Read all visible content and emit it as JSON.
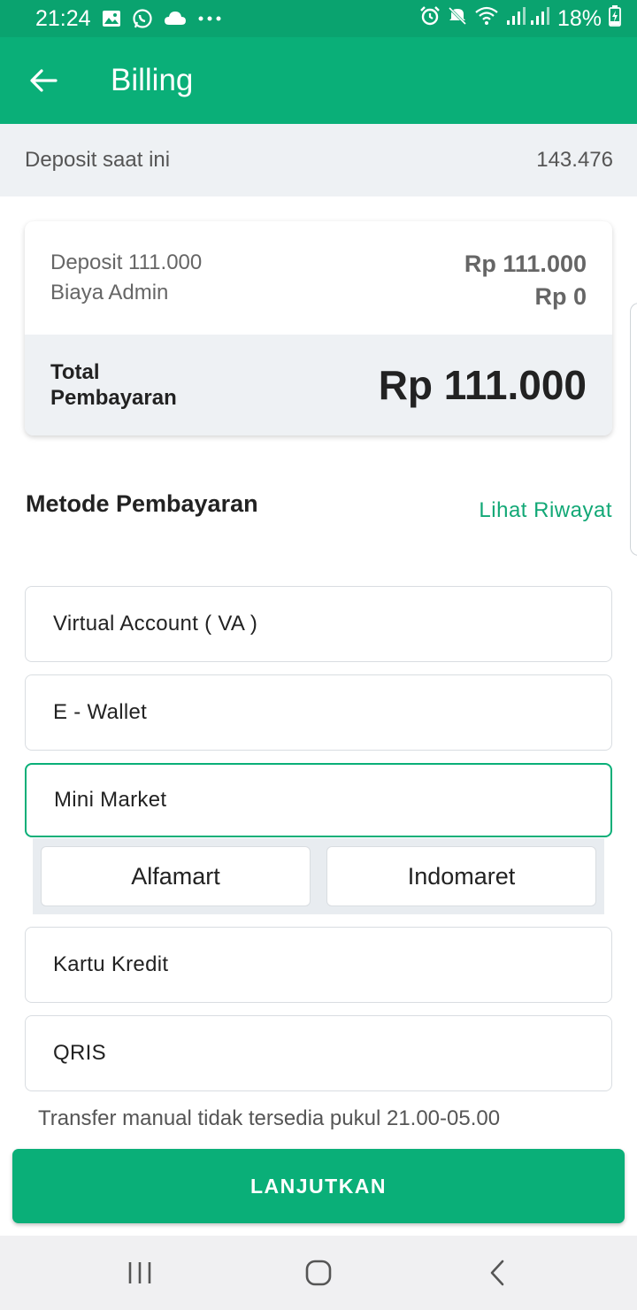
{
  "status_bar": {
    "time": "21:24",
    "battery": "18%",
    "icons": [
      "image-icon",
      "whatsapp-icon",
      "cloud-icon",
      "more-icon",
      "alarm-icon",
      "mute-icon",
      "wifi-icon",
      "signal-icon",
      "battery-charging-icon"
    ]
  },
  "app_bar": {
    "title": "Billing"
  },
  "deposit": {
    "label": "Deposit saat ini",
    "value": "143.476"
  },
  "summary": {
    "deposit_label": "Deposit 111.000",
    "deposit_value": "Rp 111.000",
    "admin_label": "Biaya Admin",
    "admin_value": "Rp 0",
    "total_label": "Total Pembayaran",
    "total_value": "Rp 111.000"
  },
  "payment": {
    "title": "Metode Pembayaran",
    "history_link": "Lihat Riwayat",
    "options": [
      {
        "label": "Virtual Account ( VA )",
        "selected": false
      },
      {
        "label": "E - Wallet",
        "selected": false
      },
      {
        "label": "Mini Market",
        "selected": true
      },
      {
        "label": "Kartu Kredit",
        "selected": false
      },
      {
        "label": "QRIS",
        "selected": false
      }
    ],
    "minimarket_options": [
      "Alfamart",
      "Indomaret"
    ]
  },
  "notice": "Transfer manual tidak tersedia pukul 21.00-05.00",
  "continue_button": "LANJUTKAN",
  "colors": {
    "primary": "#0aaf78",
    "status_bar": "#0aa36f",
    "surface_grey": "#eef1f4"
  }
}
